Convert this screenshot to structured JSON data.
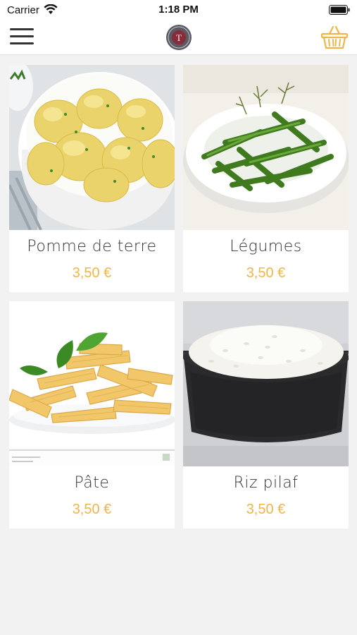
{
  "status_bar": {
    "carrier": "Carrier",
    "time": "1:18 PM"
  },
  "header": {
    "logo_letter": "T"
  },
  "products": [
    {
      "name": "Pomme de terre",
      "price": "3,50 €"
    },
    {
      "name": "Légumes",
      "price": "3,50 €"
    },
    {
      "name": "Pâte",
      "price": "3,50 €"
    },
    {
      "name": "Riz pilaf",
      "price": "3,50 €"
    }
  ],
  "colors": {
    "price": "#f0b54a",
    "cart_icon": "#f0b54a",
    "background": "#f2f2f2"
  }
}
